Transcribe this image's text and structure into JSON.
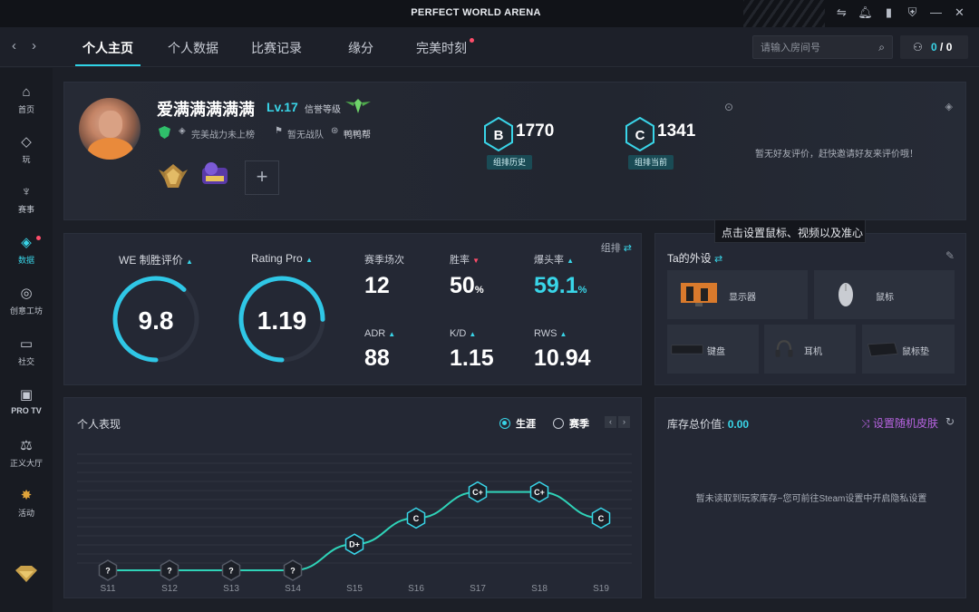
{
  "app": {
    "title": "PERFECT WORLD ARENA"
  },
  "titlebar_icons": [
    "swap-icon",
    "bell-icon",
    "signal-icon",
    "shield-icon",
    "minimize-icon",
    "close-icon"
  ],
  "nav": {
    "tabs": [
      {
        "label": "个人主页",
        "active": true
      },
      {
        "label": "个人数据"
      },
      {
        "label": "比赛记录"
      },
      {
        "label": "缘分"
      },
      {
        "label": "完美时刻",
        "dot": true
      }
    ],
    "search_placeholder": "请输入房间号",
    "friends_online": "0",
    "friends_sep": "/",
    "friends_total": "0"
  },
  "sidebar": {
    "items": [
      {
        "label": "首页",
        "icon": "home-icon"
      },
      {
        "label": "玩",
        "icon": "play-icon"
      },
      {
        "label": "赛事",
        "icon": "trophy-icon"
      },
      {
        "label": "数据",
        "icon": "data-icon",
        "active": true
      },
      {
        "label": "创意工坊",
        "icon": "workshop-icon"
      },
      {
        "label": "社交",
        "icon": "chat-icon"
      },
      {
        "label": "PRO TV",
        "icon": "tv-icon"
      },
      {
        "label": "正义大厅",
        "icon": "justice-icon"
      },
      {
        "label": "活动",
        "icon": "event-icon"
      }
    ]
  },
  "profile": {
    "name": "爱满满满满满",
    "level": "Lv.17",
    "credit_label": "信誉等级",
    "tags": [
      "完美战力未上榜",
      "暂无战队",
      "鸭鸭帮"
    ],
    "ranks": [
      {
        "letter": "B",
        "value": "1770",
        "label": "组排历史",
        "color": "#39d5e8"
      },
      {
        "letter": "C",
        "value": "1341",
        "label": "组排当前",
        "color": "#39d5e8"
      }
    ],
    "friend_eval_empty": "暂无好友评价，赶快邀请好友来评价哦！"
  },
  "stats": {
    "queue_label": "组排",
    "we_label": "WE 制胜评价",
    "we_value": "9.8",
    "we_fraction": 0.62,
    "rating_label": "Rating Pro",
    "rating_value": "1.19",
    "rating_fraction": 0.75,
    "matches_label": "赛季场次",
    "matches_value": "12",
    "winrate_label": "胜率",
    "winrate_value": "50",
    "winrate_unit": "%",
    "hs_label": "爆头率",
    "hs_value": "59.1",
    "hs_unit": "%",
    "adr_label": "ADR",
    "adr_value": "88",
    "kd_label": "K/D",
    "kd_value": "1.15",
    "rws_label": "RWS",
    "rws_value": "10.94"
  },
  "tooltip": "点击设置鼠标、视频以及准心",
  "gear": {
    "title": "Ta的外设",
    "items": [
      {
        "label": "显示器",
        "icon": "monitor-icon"
      },
      {
        "label": "鼠标",
        "icon": "mouse-icon"
      },
      {
        "label": "键盘",
        "icon": "keyboard-icon"
      },
      {
        "label": "耳机",
        "icon": "headset-icon"
      },
      {
        "label": "鼠标垫",
        "icon": "mousepad-icon"
      }
    ]
  },
  "performance": {
    "title": "个人表现",
    "option_career": "生涯",
    "option_event": "赛季",
    "prev": "‹",
    "next": "›"
  },
  "chart_data": {
    "type": "line",
    "title": "个人表现",
    "categories": [
      "S11",
      "S12",
      "S13",
      "S14",
      "S15",
      "S16",
      "S17",
      "S18",
      "S19"
    ],
    "series": [
      {
        "ranks": [
          "?",
          "?",
          "?",
          "?",
          "D+",
          "C",
          "C+",
          "C+",
          "C"
        ],
        "values": [
          0,
          0,
          0,
          0,
          1,
          2,
          3,
          3,
          2
        ]
      }
    ],
    "ylim": [
      0,
      4
    ],
    "color": "#2fd3b8"
  },
  "inventory": {
    "label": "库存总价值:",
    "value": "0.00",
    "random_skin": "设置随机皮肤",
    "empty": "暂未读取到玩家库存~您可前往Steam设置中开启隐私设置"
  }
}
